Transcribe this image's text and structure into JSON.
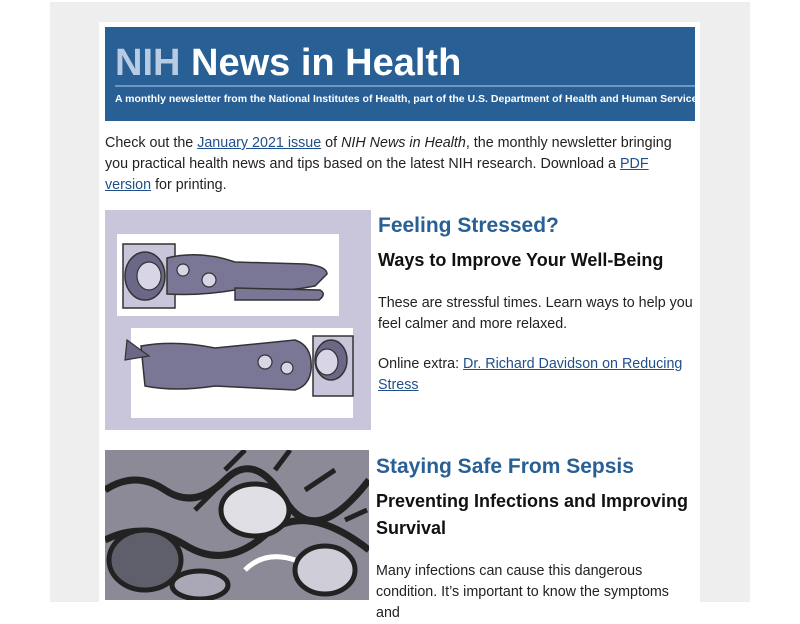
{
  "banner": {
    "title_nih": "NIH",
    "title_rest": " News in Health",
    "subtitle": "A monthly newsletter from the National Institutes of Health, part of the U.S. Department of Health and Human Services"
  },
  "intro": {
    "text1": "Check out the ",
    "link1": "January 2021 issue",
    "text2": " of ",
    "italic": "NIH News in Health",
    "text3": ", the monthly newsletter bringing you practical health news and tips based on the latest NIH research. Download a ",
    "link2": "PDF version",
    "text4": " for printing."
  },
  "stories": [
    {
      "title": "Feeling Stressed?",
      "subtitle": "Ways to Improve Your Well-Being",
      "body": "These are stressful times. Learn ways to help you feel calmer and more relaxed.",
      "extra_label": "Online extra: ",
      "extra_link": "Dr. Richard Davidson on Reducing Stress",
      "image_icon": "people-lying-down-illustration"
    },
    {
      "title": "Staying Safe From Sepsis",
      "subtitle": "Preventing Infections and Improving Survival",
      "body": "Many infections can cause this dangerous condition. It’s important to know the symptoms and",
      "image_icon": "germs-illustration"
    }
  ],
  "colors": {
    "banner": "#285f94",
    "heading": "#285f94",
    "link": "#1f4f8a",
    "page_bg": "#eeeeee"
  }
}
